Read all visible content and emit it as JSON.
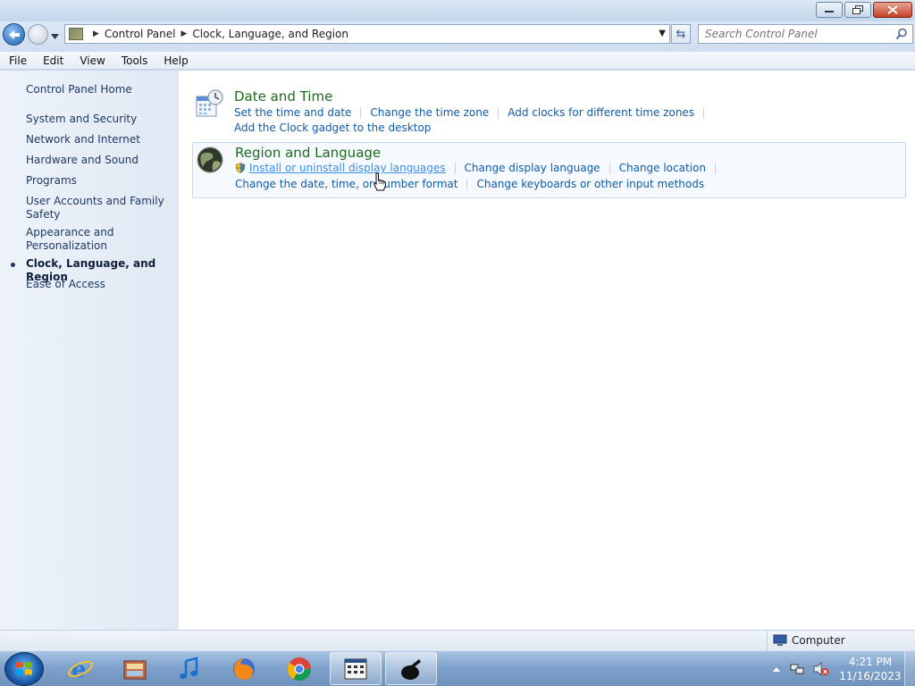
{
  "window": {
    "controls": [
      "minimize",
      "restore",
      "close"
    ]
  },
  "address": {
    "crumbs": [
      "Control Panel",
      "Clock, Language, and Region"
    ]
  },
  "search": {
    "placeholder": "Search Control Panel"
  },
  "menu": [
    "File",
    "Edit",
    "View",
    "Tools",
    "Help"
  ],
  "sidebar": {
    "home": "Control Panel Home",
    "items": [
      "System and Security",
      "Network and Internet",
      "Hardware and Sound",
      "Programs",
      "User Accounts and Family Safety",
      "Appearance and Personalization",
      "Clock, Language, and Region",
      "Ease of Access"
    ],
    "current_index": 6
  },
  "categories": {
    "datetime": {
      "title": "Date and Time",
      "icon": "calendar-clock-icon",
      "links": [
        "Set the time and date",
        "Change the time zone",
        "Add clocks for different time zones",
        "Add the Clock gadget to the desktop"
      ]
    },
    "region": {
      "title": "Region and Language",
      "icon": "globe-clock-icon",
      "links": [
        "Install or uninstall display languages",
        "Change display language",
        "Change location",
        "Change the date, time, or number format",
        "Change keyboards or other input methods"
      ]
    }
  },
  "status": {
    "zone": "Computer"
  },
  "taskbar": {
    "items": [
      "internet-explorer-icon",
      "media-center-icon",
      "itunes-icon",
      "firefox-icon",
      "chrome-icon",
      "system-monitor-icon",
      "app-icon"
    ],
    "clock_time": "4:21 PM",
    "clock_date": "11/16/2023"
  },
  "colors": {
    "link": "#0e5baa",
    "link_hover": "#3b8ee6",
    "category_title": "#1e6a1e",
    "sidebar_text": "#1f3864"
  }
}
